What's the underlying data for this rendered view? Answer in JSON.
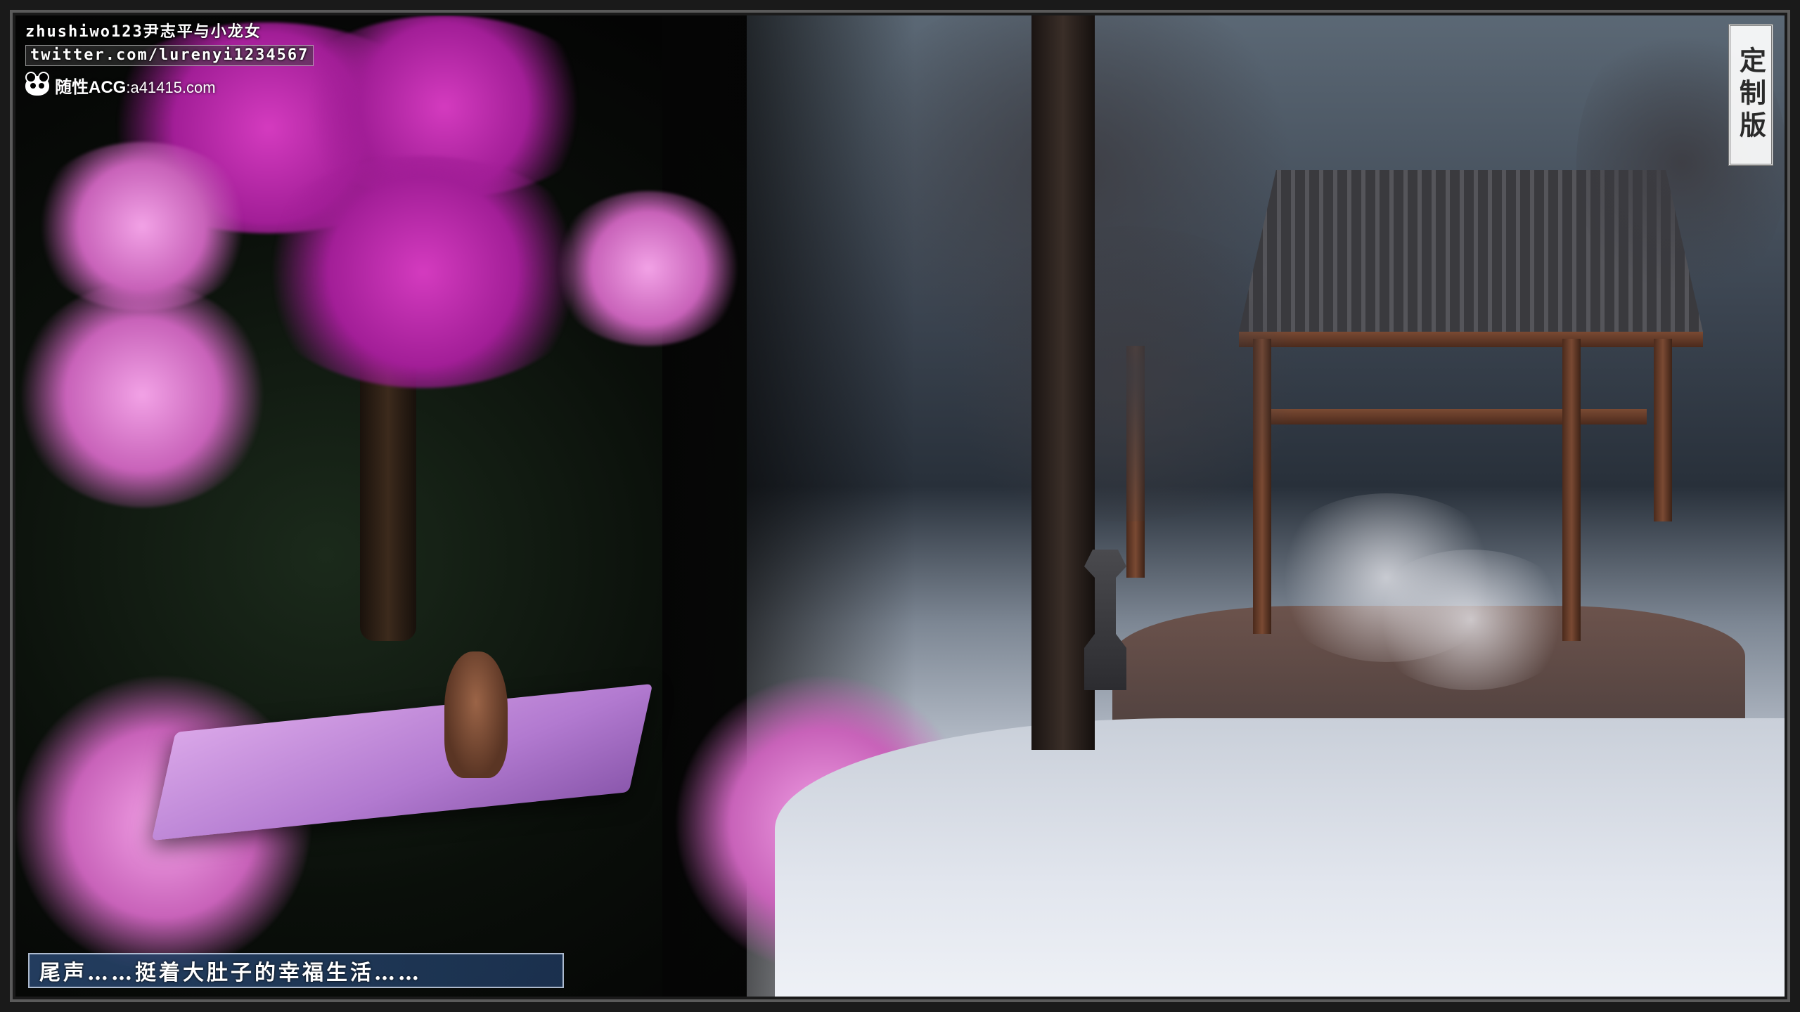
{
  "watermark": {
    "line1": "zhushiwo123尹志平与小龙女",
    "line2": "twitter.com/lurenyi1234567",
    "site_brand": "随性ACG",
    "site_domain": ":a41415.com",
    "icon": "panda-icon"
  },
  "edition_badge": "定制版",
  "caption": "尾声……挺着大肚子的幸福生活……",
  "colors": {
    "blossom": "#c42db4",
    "caption_bg": "#2c4a74",
    "snow": "#e6eaf1"
  }
}
